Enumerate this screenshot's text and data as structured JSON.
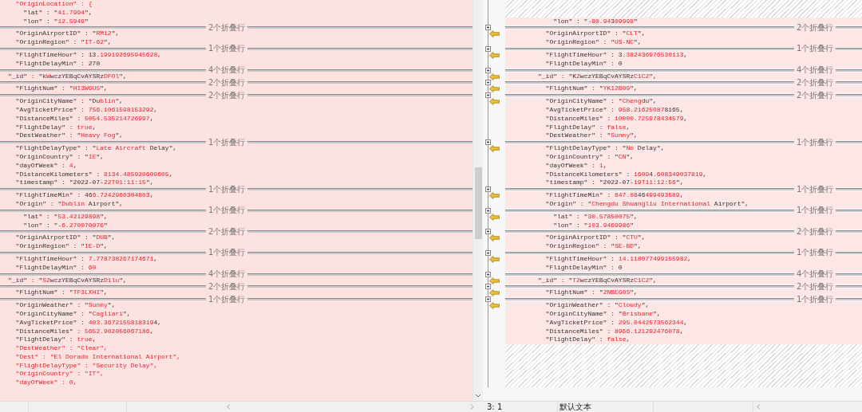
{
  "left": {
    "sections": [
      {
        "lines": [
          {
            "kind": "code",
            "segments": [
              {
                "text": "  \"OriginLocation\" : {",
                "changed": true
              }
            ]
          },
          {
            "kind": "code",
            "segments": [
              {
                "text": "    \"lat\" : \"",
                "changed": false
              },
              {
                "text": "41.7994",
                "changed": true
              },
              {
                "text": "\",",
                "changed": false
              }
            ]
          },
          {
            "kind": "code",
            "segments": [
              {
                "text": "    \"lon\" : \"",
                "changed": false
              },
              {
                "text": "12.5949",
                "changed": true
              },
              {
                "text": "\"",
                "changed": false
              }
            ]
          }
        ]
      },
      {
        "fold_label": "2个折叠行",
        "lines": [
          {
            "kind": "code",
            "segments": [
              {
                "text": "  \"OriginAirportID\" : \"",
                "changed": false
              },
              {
                "text": "RM12",
                "changed": true
              },
              {
                "text": "\",",
                "changed": false
              }
            ]
          },
          {
            "kind": "code",
            "segments": [
              {
                "text": "  \"OriginRegion\" : \"",
                "changed": false
              },
              {
                "text": "IT-62",
                "changed": true
              },
              {
                "text": "\",",
                "changed": false
              }
            ]
          }
        ]
      },
      {
        "fold_label": "1个折叠行",
        "lines": [
          {
            "kind": "code",
            "segments": [
              {
                "text": "  \"FlightTimeHour\" : 13.",
                "changed": false
              },
              {
                "text": "199192695945628",
                "changed": true
              },
              {
                "text": ",",
                "changed": false
              }
            ]
          },
          {
            "kind": "code",
            "segments": [
              {
                "text": "  \"FlightDelayMin\" : 270",
                "changed": false
              }
            ]
          }
        ]
      },
      {
        "fold_label": "4个折叠行",
        "lines": [
          {
            "kind": "code",
            "segments": [
              {
                "text": "\"_id\" : \"k",
                "changed": false
              },
              {
                "text": "W",
                "changed": true
              },
              {
                "text": "wczYEBqCvAYSRz",
                "changed": false
              },
              {
                "text": "DFOl",
                "changed": true
              },
              {
                "text": "\",",
                "changed": false
              }
            ]
          }
        ]
      },
      {
        "fold_label": "2个折叠行",
        "lines": [
          {
            "kind": "code",
            "segments": [
              {
                "text": "  \"FlightNum\" : \"",
                "changed": false
              },
              {
                "text": "HI3W6U5",
                "changed": true
              },
              {
                "text": "\",",
                "changed": false
              }
            ]
          }
        ]
      },
      {
        "fold_label": "2个折叠行",
        "lines": [
          {
            "kind": "code",
            "segments": [
              {
                "text": "  \"OriginCityName\" : \"Du",
                "changed": false
              },
              {
                "text": "blin",
                "changed": true
              },
              {
                "text": "\",",
                "changed": false
              }
            ]
          },
          {
            "kind": "code",
            "segments": [
              {
                "text": "  \"AvgTicketPrice\" : ",
                "changed": false
              },
              {
                "text": "756.1061598153292",
                "changed": true
              },
              {
                "text": ",",
                "changed": false
              }
            ]
          },
          {
            "kind": "code",
            "segments": [
              {
                "text": "  \"DistanceMiles\" : ",
                "changed": false
              },
              {
                "text": "5054.535214726997",
                "changed": true
              },
              {
                "text": ",",
                "changed": false
              }
            ]
          },
          {
            "kind": "code",
            "segments": [
              {
                "text": "  \"FlightDelay\" : ",
                "changed": false
              },
              {
                "text": "true",
                "changed": true
              },
              {
                "text": ",",
                "changed": false
              }
            ]
          },
          {
            "kind": "code",
            "segments": [
              {
                "text": "  \"DestWeather\" : \"",
                "changed": false
              },
              {
                "text": "Heavy Fog",
                "changed": true
              },
              {
                "text": "\",",
                "changed": false
              }
            ]
          }
        ]
      },
      {
        "fold_label": "1个折叠行",
        "lines": [
          {
            "kind": "code",
            "segments": [
              {
                "text": "  \"FlightDelayType\" : \"",
                "changed": false
              },
              {
                "text": "Late Aircraft",
                "changed": true
              },
              {
                "text": " Delay\",",
                "changed": false
              }
            ]
          },
          {
            "kind": "code",
            "segments": [
              {
                "text": "  \"OriginCountry\" : \"",
                "changed": false
              },
              {
                "text": "IE",
                "changed": true
              },
              {
                "text": "\",",
                "changed": false
              }
            ]
          },
          {
            "kind": "code",
            "segments": [
              {
                "text": "  \"dayOfWeek\" : ",
                "changed": false
              },
              {
                "text": "4",
                "changed": true
              },
              {
                "text": ",",
                "changed": false
              }
            ]
          },
          {
            "kind": "code",
            "segments": [
              {
                "text": "  \"DistanceKilometers\" : ",
                "changed": false
              },
              {
                "text": "8134.485920609605",
                "changed": true
              },
              {
                "text": ",",
                "changed": false
              }
            ]
          },
          {
            "kind": "code",
            "segments": [
              {
                "text": "  \"timestamp\" : \"2022-07-",
                "changed": false
              },
              {
                "text": "22T01",
                "changed": true
              },
              {
                "text": ":",
                "changed": false
              },
              {
                "text": "11",
                "changed": true
              },
              {
                "text": ":",
                "changed": false
              },
              {
                "text": "15",
                "changed": true
              },
              {
                "text": "\",",
                "changed": false
              }
            ]
          }
        ]
      },
      {
        "fold_label": "1个折叠行",
        "lines": [
          {
            "kind": "code",
            "segments": [
              {
                "text": "  \"FlightTimeMin\" : 46",
                "changed": false
              },
              {
                "text": "6.7242960304803",
                "changed": true
              },
              {
                "text": ",",
                "changed": false
              }
            ]
          },
          {
            "kind": "code",
            "segments": [
              {
                "text": "  \"Origin\" : \"",
                "changed": false
              },
              {
                "text": "Dublin",
                "changed": true
              },
              {
                "text": " Airport\",",
                "changed": false
              }
            ]
          }
        ]
      },
      {
        "fold_label": "1个折叠行",
        "lines": [
          {
            "kind": "code",
            "segments": [
              {
                "text": "    \"lat\" : \"",
                "changed": false
              },
              {
                "text": "53.42129898",
                "changed": true
              },
              {
                "text": "\",",
                "changed": false
              }
            ]
          },
          {
            "kind": "code",
            "segments": [
              {
                "text": "    \"lon\" : \"",
                "changed": false
              },
              {
                "text": "-6.270070076",
                "changed": true
              },
              {
                "text": "\"",
                "changed": false
              }
            ]
          }
        ]
      },
      {
        "fold_label": "2个折叠行",
        "lines": [
          {
            "kind": "code",
            "segments": [
              {
                "text": "  \"OriginAirportID\" : \"",
                "changed": false
              },
              {
                "text": "DUB",
                "changed": true
              },
              {
                "text": "\",",
                "changed": false
              }
            ]
          },
          {
            "kind": "code",
            "segments": [
              {
                "text": "  \"OriginRegion\" : \"",
                "changed": false
              },
              {
                "text": "IE-D",
                "changed": true
              },
              {
                "text": "\",",
                "changed": false
              }
            ]
          }
        ]
      },
      {
        "fold_label": "1个折叠行",
        "lines": [
          {
            "kind": "code",
            "segments": [
              {
                "text": "  \"FlightTimeHour\" : ",
                "changed": false
              },
              {
                "text": "7.778738267174671",
                "changed": true
              },
              {
                "text": ",",
                "changed": false
              }
            ]
          },
          {
            "kind": "code",
            "segments": [
              {
                "text": "  \"FlightDelayMin\" : ",
                "changed": false
              },
              {
                "text": "60",
                "changed": true
              }
            ]
          }
        ]
      },
      {
        "fold_label": "4个折叠行",
        "lines": [
          {
            "kind": "code",
            "segments": [
              {
                "text": "\"_id\" : \"",
                "changed": false
              },
              {
                "text": "S2",
                "changed": true
              },
              {
                "text": "wczYEBqCvAYSRz",
                "changed": false
              },
              {
                "text": "D1lu",
                "changed": true
              },
              {
                "text": "\",",
                "changed": false
              }
            ]
          }
        ]
      },
      {
        "fold_label": "2个折叠行",
        "lines": [
          {
            "kind": "code",
            "segments": [
              {
                "text": "  \"FlightNum\" : \"",
                "changed": false
              },
              {
                "text": "TF3LXHI",
                "changed": true
              },
              {
                "text": "\",",
                "changed": false
              }
            ]
          }
        ]
      },
      {
        "fold_label": "1个折叠行",
        "lines": [
          {
            "kind": "code",
            "segments": [
              {
                "text": "  \"OriginWeather\" : \"",
                "changed": false
              },
              {
                "text": "Sunny",
                "changed": true
              },
              {
                "text": "\",",
                "changed": false
              }
            ]
          },
          {
            "kind": "code",
            "segments": [
              {
                "text": "  \"OriginCityName\" : \"",
                "changed": false
              },
              {
                "text": "Cagliari",
                "changed": true
              },
              {
                "text": "\",",
                "changed": false
              }
            ]
          },
          {
            "kind": "code",
            "segments": [
              {
                "text": "  \"AvgTicketPrice\" : ",
                "changed": false
              },
              {
                "text": "403.3672155818319",
                "changed": true
              },
              {
                "text": "4,",
                "changed": false
              }
            ]
          },
          {
            "kind": "code",
            "segments": [
              {
                "text": "  \"DistanceMiles\" : ",
                "changed": false
              },
              {
                "text": "5652.902056067186",
                "changed": true
              },
              {
                "text": ",",
                "changed": false
              }
            ]
          },
          {
            "kind": "code",
            "segments": [
              {
                "text": "  \"FlightDelay\" : ",
                "changed": false
              },
              {
                "text": "true",
                "changed": true
              },
              {
                "text": ",",
                "changed": false
              }
            ]
          },
          {
            "kind": "code",
            "segments": [
              {
                "text": "  \"DestWeather\" : \"Clear\",",
                "changed": true
              }
            ]
          },
          {
            "kind": "code",
            "segments": [
              {
                "text": "  \"Dest\" : \"El Dorado International Airport\",",
                "changed": true
              }
            ]
          },
          {
            "kind": "code",
            "segments": [
              {
                "text": "  \"FlightDelayType\" : \"Security Delay\",",
                "changed": true
              }
            ]
          },
          {
            "kind": "code",
            "segments": [
              {
                "text": "  \"OriginCountry\" : \"IT\",",
                "changed": true
              }
            ]
          },
          {
            "kind": "code",
            "segments": [
              {
                "text": "  \"dayOfWeek\" : 0,",
                "changed": true
              }
            ]
          }
        ]
      }
    ]
  },
  "right": {
    "sections": [
      {
        "lines": [
          {
            "kind": "blank"
          },
          {
            "kind": "blank"
          },
          {
            "kind": "code",
            "segments": [
              {
                "text": "    \"lon\" : \"",
                "changed": false
              },
              {
                "text": "-80.94",
                "changed": true
              },
              {
                "text": "3",
                "changed": false
              },
              {
                "text": "09998",
                "changed": true
              },
              {
                "text": "\"",
                "changed": false
              }
            ]
          }
        ]
      },
      {
        "fold_label": "2个折叠行",
        "lines": [
          {
            "kind": "code",
            "segments": [
              {
                "text": "  \"OriginAirportID\" : \"",
                "changed": false
              },
              {
                "text": "CLT",
                "changed": true
              },
              {
                "text": "\",",
                "changed": false
              }
            ]
          },
          {
            "kind": "code",
            "segments": [
              {
                "text": "  \"OriginRegion\" : \"",
                "changed": false
              },
              {
                "text": "US-NC",
                "changed": true
              },
              {
                "text": "\",",
                "changed": false
              }
            ]
          }
        ]
      },
      {
        "fold_label": "1个折叠行",
        "lines": [
          {
            "kind": "code",
            "segments": [
              {
                "text": "  \"FlightTimeHour\" : 3.",
                "changed": false
              },
              {
                "text": "382436976530113",
                "changed": true
              },
              {
                "text": ",",
                "changed": false
              }
            ]
          },
          {
            "kind": "code",
            "segments": [
              {
                "text": "  \"FlightDelayMin\" : 0",
                "changed": false
              }
            ]
          }
        ]
      },
      {
        "fold_label": "4个折叠行",
        "lines": [
          {
            "kind": "code",
            "segments": [
              {
                "text": "\"_id\" : \"K",
                "changed": false
              },
              {
                "text": "2",
                "changed": true
              },
              {
                "text": "wczYEBqCvAYSRz",
                "changed": false
              },
              {
                "text": "C1C2",
                "changed": true
              },
              {
                "text": "\",",
                "changed": false
              }
            ]
          }
        ]
      },
      {
        "fold_label": "2个折叠行",
        "lines": [
          {
            "kind": "code",
            "segments": [
              {
                "text": "  \"FlightNum\" : \"",
                "changed": false
              },
              {
                "text": "YK12B09",
                "changed": true
              },
              {
                "text": "\",",
                "changed": false
              }
            ]
          }
        ]
      },
      {
        "fold_label": "2个折叠行",
        "lines": [
          {
            "kind": "code",
            "segments": [
              {
                "text": "  \"OriginCityName\" : \"",
                "changed": false
              },
              {
                "text": "Cheng",
                "changed": true
              },
              {
                "text": "du\",",
                "changed": false
              }
            ]
          },
          {
            "kind": "code",
            "segments": [
              {
                "text": "  \"AvgTicketPrice\" : ",
                "changed": false
              },
              {
                "text": "958.21625087",
                "changed": true
              },
              {
                "text": "8165,",
                "changed": false
              }
            ]
          },
          {
            "kind": "code",
            "segments": [
              {
                "text": "  \"DistanceMiles\" : ",
                "changed": false
              },
              {
                "text": "10000.725978434579",
                "changed": true
              },
              {
                "text": ",",
                "changed": false
              }
            ]
          },
          {
            "kind": "code",
            "segments": [
              {
                "text": "  \"FlightDelay\" : ",
                "changed": false
              },
              {
                "text": "false",
                "changed": true
              },
              {
                "text": ",",
                "changed": false
              }
            ]
          },
          {
            "kind": "code",
            "segments": [
              {
                "text": "  \"DestWeather\" : \"",
                "changed": false
              },
              {
                "text": "Sunny",
                "changed": true
              },
              {
                "text": "\",",
                "changed": false
              }
            ]
          }
        ]
      },
      {
        "fold_label": "1个折叠行",
        "lines": [
          {
            "kind": "code",
            "segments": [
              {
                "text": "  \"FlightDelayType\" : \"",
                "changed": false
              },
              {
                "text": "No",
                "changed": true
              },
              {
                "text": " Delay\",",
                "changed": false
              }
            ]
          },
          {
            "kind": "code",
            "segments": [
              {
                "text": "  \"OriginCountry\" : \"",
                "changed": false
              },
              {
                "text": "CN",
                "changed": true
              },
              {
                "text": "\",",
                "changed": false
              }
            ]
          },
          {
            "kind": "code",
            "segments": [
              {
                "text": "  \"dayOfWeek\" : ",
                "changed": false
              },
              {
                "text": "1",
                "changed": true
              },
              {
                "text": ",",
                "changed": false
              }
            ]
          },
          {
            "kind": "code",
            "segments": [
              {
                "text": "  \"DistanceKilometers\" : ",
                "changed": false
              },
              {
                "text": "1609",
                "changed": true
              },
              {
                "text": "4",
                "changed": false
              },
              {
                "text": ".608349037819",
                "changed": true
              },
              {
                "text": ",",
                "changed": false
              }
            ]
          },
          {
            "kind": "code",
            "segments": [
              {
                "text": "  \"timestamp\" : \"2022-07-",
                "changed": false
              },
              {
                "text": "19T11",
                "changed": true
              },
              {
                "text": ":",
                "changed": false
              },
              {
                "text": "12",
                "changed": true
              },
              {
                "text": ":",
                "changed": false
              },
              {
                "text": "56",
                "changed": true
              },
              {
                "text": "\",",
                "changed": false
              }
            ]
          }
        ]
      },
      {
        "fold_label": "1个折叠行",
        "lines": [
          {
            "kind": "code",
            "segments": [
              {
                "text": "  \"FlightTimeMin\" : ",
                "changed": false
              },
              {
                "text": "847.08",
                "changed": true
              },
              {
                "text": "46",
                "changed": false
              },
              {
                "text": "499493589",
                "changed": true
              },
              {
                "text": ",",
                "changed": false
              }
            ]
          },
          {
            "kind": "code",
            "segments": [
              {
                "text": "  \"Origin\" : \"",
                "changed": false
              },
              {
                "text": "Chengdu Shuangliu International",
                "changed": true
              },
              {
                "text": " Airport\",",
                "changed": false
              }
            ]
          }
        ]
      },
      {
        "fold_label": "1个折叠行",
        "lines": [
          {
            "kind": "code",
            "segments": [
              {
                "text": "    \"lat\" : \"",
                "changed": false
              },
              {
                "text": "30.57850075",
                "changed": true
              },
              {
                "text": "\",",
                "changed": false
              }
            ]
          },
          {
            "kind": "code",
            "segments": [
              {
                "text": "    \"lon\" : \"",
                "changed": false
              },
              {
                "text": "103.9469986",
                "changed": true
              },
              {
                "text": "\"",
                "changed": false
              }
            ]
          }
        ]
      },
      {
        "fold_label": "2个折叠行",
        "lines": [
          {
            "kind": "code",
            "segments": [
              {
                "text": "  \"OriginAirportID\" : \"",
                "changed": false
              },
              {
                "text": "CTU",
                "changed": true
              },
              {
                "text": "\",",
                "changed": false
              }
            ]
          },
          {
            "kind": "code",
            "segments": [
              {
                "text": "  \"OriginRegion\" : \"",
                "changed": false
              },
              {
                "text": "SE-BD",
                "changed": true
              },
              {
                "text": "\",",
                "changed": false
              }
            ]
          }
        ]
      },
      {
        "fold_label": "1个折叠行",
        "lines": [
          {
            "kind": "code",
            "segments": [
              {
                "text": "  \"FlightTimeHour\" : ",
                "changed": false
              },
              {
                "text": "14.118077499155982",
                "changed": true
              },
              {
                "text": ",",
                "changed": false
              }
            ]
          },
          {
            "kind": "code",
            "segments": [
              {
                "text": "  \"FlightDelayMin\" : 0",
                "changed": false
              }
            ]
          }
        ]
      },
      {
        "fold_label": "4个折叠行",
        "lines": [
          {
            "kind": "code",
            "segments": [
              {
                "text": "\"_id\" : \"",
                "changed": false
              },
              {
                "text": "T2",
                "changed": true
              },
              {
                "text": "wczYEBqCvAYSRz",
                "changed": false
              },
              {
                "text": "C1C2",
                "changed": true
              },
              {
                "text": "\",",
                "changed": false
              }
            ]
          }
        ]
      },
      {
        "fold_label": "2个折叠行",
        "lines": [
          {
            "kind": "code",
            "segments": [
              {
                "text": "  \"FlightNum\" : \"",
                "changed": false
              },
              {
                "text": "2NBEG0S",
                "changed": true
              },
              {
                "text": "\",",
                "changed": false
              }
            ]
          }
        ]
      },
      {
        "fold_label": "1个折叠行",
        "lines": [
          {
            "kind": "code",
            "segments": [
              {
                "text": "  \"OriginWeather\" : \"",
                "changed": false
              },
              {
                "text": "Cloudy",
                "changed": true
              },
              {
                "text": "\",",
                "changed": false
              }
            ]
          },
          {
            "kind": "code",
            "segments": [
              {
                "text": "  \"OriginCityName\" : \"",
                "changed": false
              },
              {
                "text": "Brisbane",
                "changed": true
              },
              {
                "text": "\",",
                "changed": false
              }
            ]
          },
          {
            "kind": "code",
            "segments": [
              {
                "text": "  \"AvgTicketPrice\" : ",
                "changed": false
              },
              {
                "text": "295.0442573562344",
                "changed": true
              },
              {
                "text": ",",
                "changed": false
              }
            ]
          },
          {
            "kind": "code",
            "segments": [
              {
                "text": "  \"DistanceMiles\" : ",
                "changed": false
              },
              {
                "text": "8966.121292476078",
                "changed": true
              },
              {
                "text": ",",
                "changed": false
              }
            ]
          },
          {
            "kind": "code",
            "segments": [
              {
                "text": "  \"FlightDelay\" : ",
                "changed": false
              },
              {
                "text": "false",
                "changed": true
              },
              {
                "text": ",",
                "changed": false
              }
            ]
          },
          {
            "kind": "blank"
          },
          {
            "kind": "blank"
          },
          {
            "kind": "blank"
          },
          {
            "kind": "blank"
          },
          {
            "kind": "blank"
          }
        ]
      }
    ]
  },
  "status_bar": {
    "cursor": "3: 1",
    "text_format": "默认文本"
  }
}
